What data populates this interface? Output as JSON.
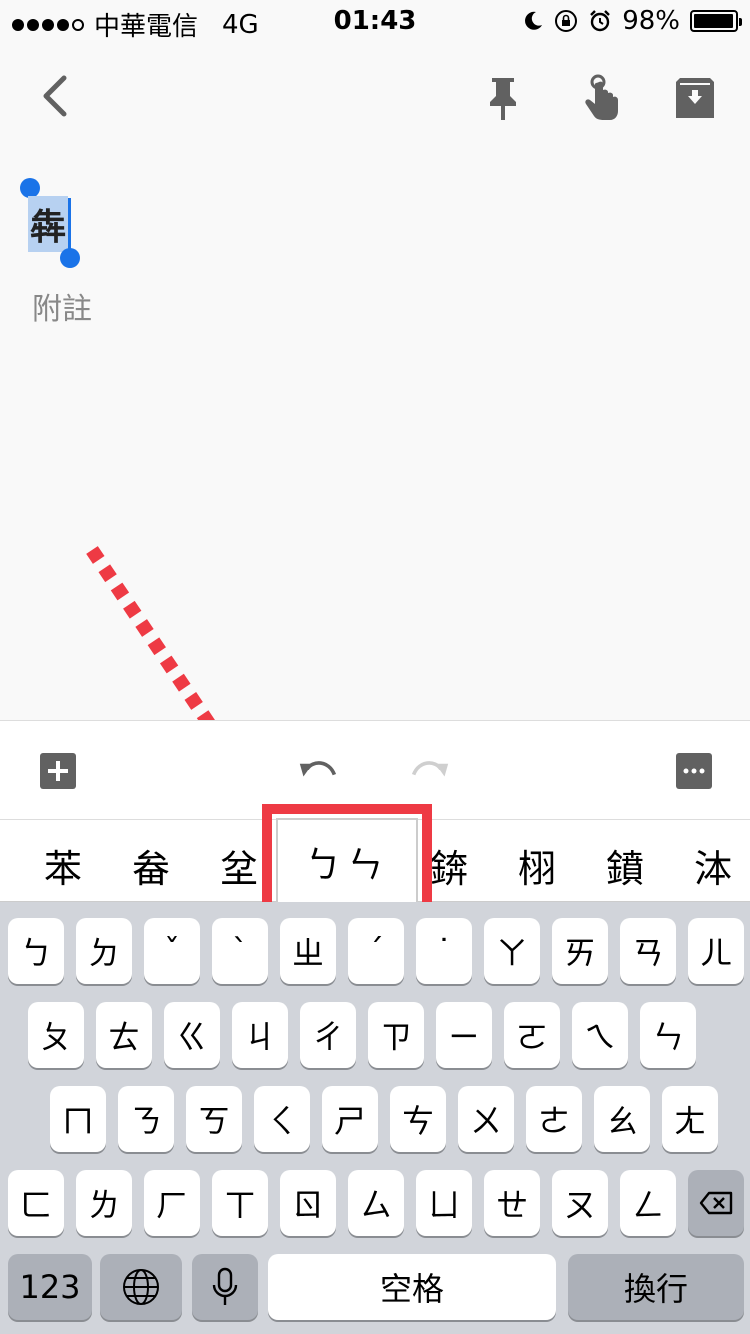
{
  "status": {
    "carrier": "中華電信",
    "network": "4G",
    "time": "01:43",
    "battery": "98%",
    "battery_level": 0.98
  },
  "note": {
    "selected_text": "犇",
    "placeholder": "附註"
  },
  "candidates": [
    "苯",
    "畚",
    "坌",
    "ㄅㄣ",
    "錛",
    "栩",
    "鐼",
    "泍"
  ],
  "keyboard": {
    "row1": [
      "ㄅ",
      "ㄉ",
      "ˇ",
      "ˋ",
      "ㄓ",
      "ˊ",
      "˙",
      "ㄚ",
      "ㄞ",
      "ㄢ",
      "ㄦ"
    ],
    "row2": [
      "ㄆ",
      "ㄊ",
      "ㄍ",
      "ㄐ",
      "ㄔ",
      "ㄗ",
      "ㄧ",
      "ㄛ",
      "ㄟ",
      "ㄣ"
    ],
    "row3": [
      "ㄇ",
      "ㄋ",
      "ㄎ",
      "ㄑ",
      "ㄕ",
      "ㄘ",
      "ㄨ",
      "ㄜ",
      "ㄠ",
      "ㄤ"
    ],
    "row4": [
      "ㄈ",
      "ㄌ",
      "ㄏ",
      "ㄒ",
      "ㄖ",
      "ㄙ",
      "ㄩ",
      "ㄝ",
      "ㄡ",
      "ㄥ"
    ],
    "numbers_label": "123",
    "space_label": "空格",
    "return_label": "換行"
  },
  "colors": {
    "highlight": "#ee3a44",
    "selection": "#b7d1f1",
    "handle": "#1a73e8"
  }
}
